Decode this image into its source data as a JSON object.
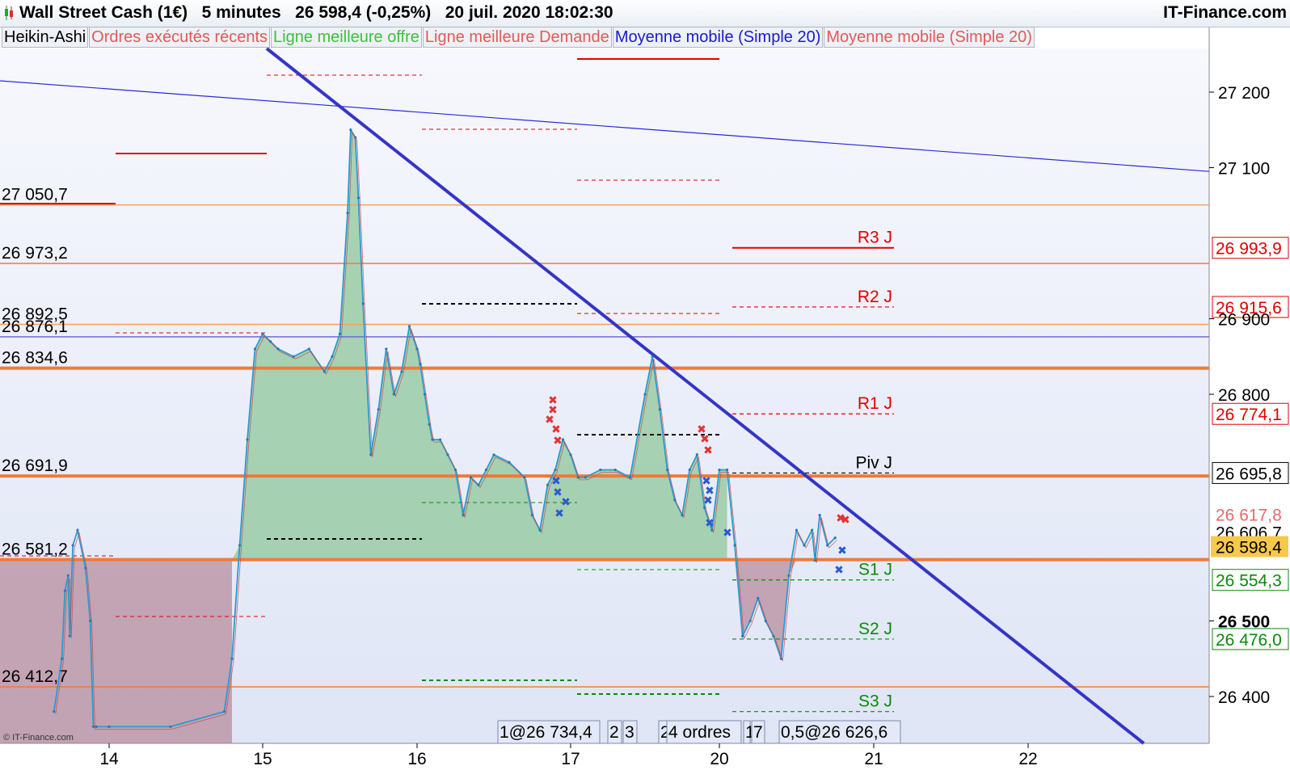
{
  "header": {
    "title": "Wall Street Cash (1€)   5 minutes   26 598,4 (-0,25%)   20 juil. 2020 18:02:30",
    "site": "IT-Finance.com"
  },
  "legend": [
    {
      "label": "Heikin-Ashi",
      "color": "#000000"
    },
    {
      "label": "Ordres exécutés récents",
      "color": "#e05a5a"
    },
    {
      "label": "Ligne meilleure offre",
      "color": "#3fbf3f"
    },
    {
      "label": "Ligne meilleure Demande",
      "color": "#e05a5a"
    },
    {
      "label": "Moyenne mobile (Simple 20)",
      "color": "#1a1ad0"
    },
    {
      "label": "Moyenne mobile (Simple 20)",
      "color": "#e05a5a"
    }
  ],
  "watermark": "© IT-Finance.com",
  "chart_data": {
    "type": "line",
    "instrument": "Wall Street Cash (1€)",
    "timeframe": "5 minutes",
    "last_price": 26598.4,
    "change_pct": -0.25,
    "x_tick_labels": [
      "14",
      "15",
      "16",
      "17",
      "20",
      "21",
      "22"
    ],
    "y_ticks": [
      27200,
      27100,
      26900,
      26800,
      26500,
      26400
    ],
    "y_tick_labels": [
      "27 200",
      "27 100",
      "26 900",
      "26 800",
      "26 500",
      "26 400"
    ],
    "ylim": [
      26340,
      27260
    ],
    "series": [
      {
        "x": [
          13.65,
          13.7,
          13.72,
          13.74,
          13.75,
          13.77,
          13.8,
          13.85,
          13.88,
          13.9,
          13.92,
          14.0,
          14.4,
          14.75,
          14.8,
          14.85,
          14.9,
          14.95,
          15.0,
          15.05,
          15.1,
          15.2,
          15.3,
          15.4,
          15.45,
          15.5,
          15.55,
          15.57,
          15.6,
          15.62,
          15.65,
          15.7,
          15.75,
          15.8,
          15.85,
          15.9,
          15.95,
          16.0,
          16.02,
          16.05,
          16.08,
          16.1,
          16.15,
          16.2,
          16.25,
          16.3,
          16.35,
          16.4,
          16.45,
          16.5,
          16.6,
          16.7,
          16.75,
          16.8,
          16.85,
          16.9,
          16.95,
          17.0,
          17.05,
          17.1,
          17.2,
          17.3,
          17.4,
          17.5,
          17.55,
          17.6,
          17.65,
          17.7,
          17.75,
          17.8,
          17.85,
          17.9,
          17.95,
          20.0,
          20.05,
          20.1,
          20.15,
          20.2,
          20.25,
          20.3,
          20.35,
          20.4,
          20.45,
          20.5,
          20.55,
          20.6,
          20.62,
          20.65,
          20.7,
          20.75
        ],
        "values": [
          26380,
          26450,
          26540,
          26560,
          26480,
          26600,
          26620,
          26570,
          26500,
          26360,
          26360,
          26360,
          26360,
          26380,
          26450,
          26600,
          26740,
          26860,
          26880,
          26870,
          26860,
          26850,
          26860,
          26830,
          26850,
          26880,
          27040,
          27150,
          27140,
          27060,
          26920,
          26720,
          26780,
          26860,
          26800,
          26830,
          26890,
          26860,
          26840,
          26800,
          26760,
          26740,
          26740,
          26720,
          26700,
          26640,
          26690,
          26680,
          26700,
          26720,
          26710,
          26690,
          26640,
          26620,
          26680,
          26700,
          26740,
          26720,
          26690,
          26690,
          26700,
          26700,
          26690,
          26800,
          26850,
          26780,
          26700,
          26660,
          26640,
          26700,
          26720,
          26650,
          26620,
          26700,
          26700,
          26600,
          26480,
          26500,
          26530,
          26500,
          26480,
          26450,
          26560,
          26620,
          26600,
          26620,
          26580,
          26640,
          26600,
          26610
        ]
      }
    ],
    "reference_lines": [
      {
        "label": "27 050,7",
        "value": 27050.7,
        "color": "#f4a261"
      },
      {
        "label": "26 973,2",
        "value": 26973.2,
        "color": "#f07a3a"
      },
      {
        "label": "26 892,5",
        "value": 26892.5,
        "color": "#f4a261"
      },
      {
        "label": "26 876,1",
        "value": 26876.1,
        "color": "#6c6cd0"
      },
      {
        "label": "26 834,6",
        "value": 26834.6,
        "color": "#f07a3a"
      },
      {
        "label": "26 691,9",
        "value": 26691.9,
        "color": "#f07a3a"
      },
      {
        "label": "26 581,2",
        "value": 26581.2,
        "color": "#f07a3a"
      },
      {
        "label": "26 412,7",
        "value": 26412.7,
        "color": "#f07a3a"
      }
    ],
    "pivots": [
      {
        "label": "R3 J",
        "value": 26993.9,
        "price_label": "26 993,9",
        "color": "#e00000"
      },
      {
        "label": "R2 J",
        "value": 26915.6,
        "price_label": "26 915,6",
        "color": "#e00000"
      },
      {
        "label": "R1 J",
        "value": 26774.1,
        "price_label": "26 774,1",
        "color": "#e00000"
      },
      {
        "label": "Piv J",
        "value": 26695.8,
        "price_label": "26 695,8",
        "color": "#000000"
      },
      {
        "label": "S1 J",
        "value": 26554.3,
        "price_label": "26 554,3",
        "color": "#0a8a0a"
      },
      {
        "label": "S2 J",
        "value": 26476.0,
        "price_label": "26 476,0",
        "color": "#0a8a0a"
      },
      {
        "label": "S3 J",
        "value": 26380.0,
        "price_label": "",
        "color": "#0a8a0a"
      }
    ],
    "right_price_labels": [
      {
        "text": "26 617,8",
        "value": 26617.8,
        "color": "#e86a6a"
      },
      {
        "text": "26 606,7",
        "value": 26606.7,
        "color": "#000000"
      },
      {
        "text": "26 598,4",
        "value": 26598.4,
        "color": "#000000",
        "highlight": "#f7c84a"
      }
    ],
    "order_boxes": [
      "1@26 734,4",
      "2",
      "3",
      "2",
      "4 ordres",
      "1",
      "7",
      "0,5@26 626,6"
    ],
    "grid": false
  }
}
